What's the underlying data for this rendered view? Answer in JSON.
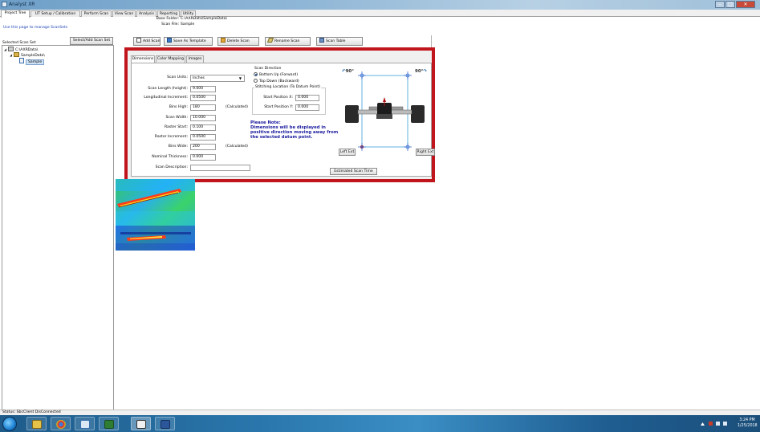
{
  "window": {
    "title": "Analyst XR"
  },
  "main_tabs": [
    {
      "label": "Project Tree"
    },
    {
      "label": "UT Setup / Calibration"
    },
    {
      "label": "Perform Scan"
    },
    {
      "label": "View Scan"
    },
    {
      "label": "Analysis"
    },
    {
      "label": "Reporting"
    },
    {
      "label": "Utility"
    }
  ],
  "sidebar": {
    "description": "Use this page to manage ScanSets",
    "selected_label": "Selected Scan Set",
    "select_button": "Select/Add Scan Set",
    "tree": [
      {
        "label": "C:\\AXRData\\",
        "icon": "drive-icon"
      },
      {
        "label": "SampleData\\",
        "icon": "folder-icon"
      },
      {
        "label": "Sample",
        "icon": "scanset-icon",
        "selected": true
      }
    ]
  },
  "folder_info": {
    "base_folder_label": "Base Folder:",
    "base_folder_value": "C:\\AXRData\\SampleData\\",
    "scan_file_label": "Scan File:",
    "scan_file_value": "Sample"
  },
  "toolbar": {
    "add_scan": "Add Scan",
    "save_template": "Save As Template",
    "delete_scan": "Delete Scan",
    "rename_scan": "Rename Scan",
    "scan_table": "Scan Table"
  },
  "inner_tabs": [
    {
      "label": "Dimensions"
    },
    {
      "label": "Color Mapping"
    },
    {
      "label": "Images"
    }
  ],
  "dimensions": {
    "scan_units_label": "Scan Units:",
    "scan_units_value": "Inches",
    "scan_length_label": "Scan Length (height):",
    "scan_length_value": "9.000",
    "long_inc_label": "Longitudinal Increment:",
    "long_inc_value": "0.0500",
    "bins_high_label": "Bins High:",
    "bins_high_value": "180",
    "calculated_1": "(Calculated)",
    "scan_width_label": "Scan Width:",
    "scan_width_value": "10.000",
    "raster_start_label": "Raster Start:",
    "raster_start_value": "0.100",
    "raster_inc_label": "Raster Increment:",
    "raster_inc_value": "0.0500",
    "bins_wide_label": "Bins Wide:",
    "bins_wide_value": "200",
    "calculated_2": "(Calculated)",
    "nominal_thickness_label": "Nominal Thickness:",
    "nominal_thickness_value": "0.000",
    "scan_description_label": "Scan Description:",
    "scan_description_value": ""
  },
  "scan_direction": {
    "title": "Scan Direction",
    "option_1": "Bottom Up (Forward)",
    "option_2": "Top Down (Backward)",
    "selected": "Bottom Up (Forward)"
  },
  "stitching": {
    "title": "Stitching Location  (To Datum Point)",
    "pos_x_label": "Start Position X:",
    "pos_x_value": "0.000",
    "pos_y_label": "Start Position Y:",
    "pos_y_value": "0.000"
  },
  "note": {
    "heading": "Please Note:",
    "body": "Dimensions will be displayed in positive direction moving away from the selected datum point."
  },
  "schematic": {
    "rotate_left_label": "90°",
    "rotate_right_label": "90°",
    "left_ext_button": "Left Ext",
    "right_ext_button": "Right Ext"
  },
  "estimated_scan_time_button": "Estimated Scan Time",
  "status_bar": {
    "text": "Status: SbcClient DisConnected"
  },
  "taskbar": {
    "time": "3:24 PM",
    "date": "1/25/2018"
  },
  "colors": {
    "highlight_border": "#c0151c",
    "note_text": "#1b1b9e",
    "link_text": "#1a3fb5",
    "taskbar": "#2a77ad"
  }
}
